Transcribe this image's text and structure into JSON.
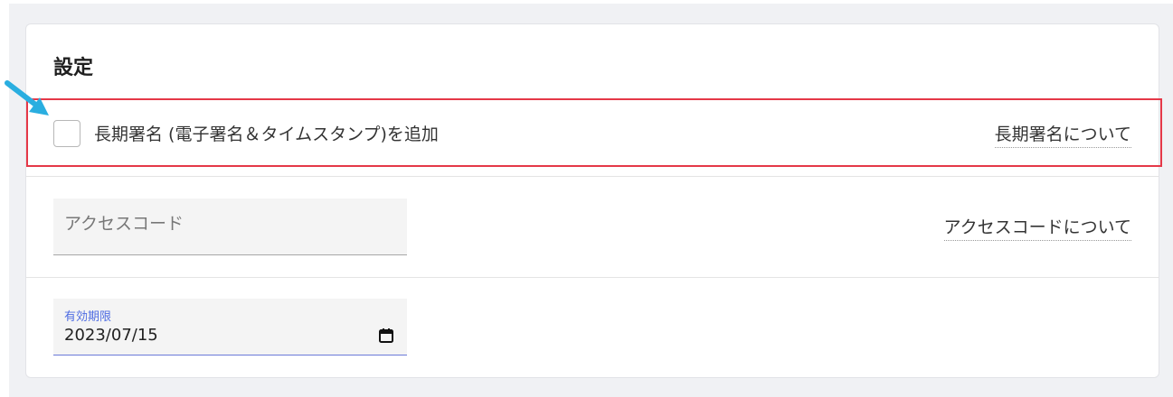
{
  "settings": {
    "title": "設定",
    "long_term_signature": {
      "label": "長期署名 (電子署名＆タイムスタンプ)を追加",
      "checked": false,
      "help_link": "長期署名について"
    },
    "access_code": {
      "placeholder": "アクセスコード",
      "value": "",
      "help_link": "アクセスコードについて"
    },
    "expiry": {
      "label": "有効期限",
      "value": "2023/07/15",
      "icon": "calendar-icon"
    }
  },
  "colors": {
    "highlight_border": "#e53848",
    "annotation_arrow": "#2aaee0",
    "date_accent": "#4f6de2"
  }
}
